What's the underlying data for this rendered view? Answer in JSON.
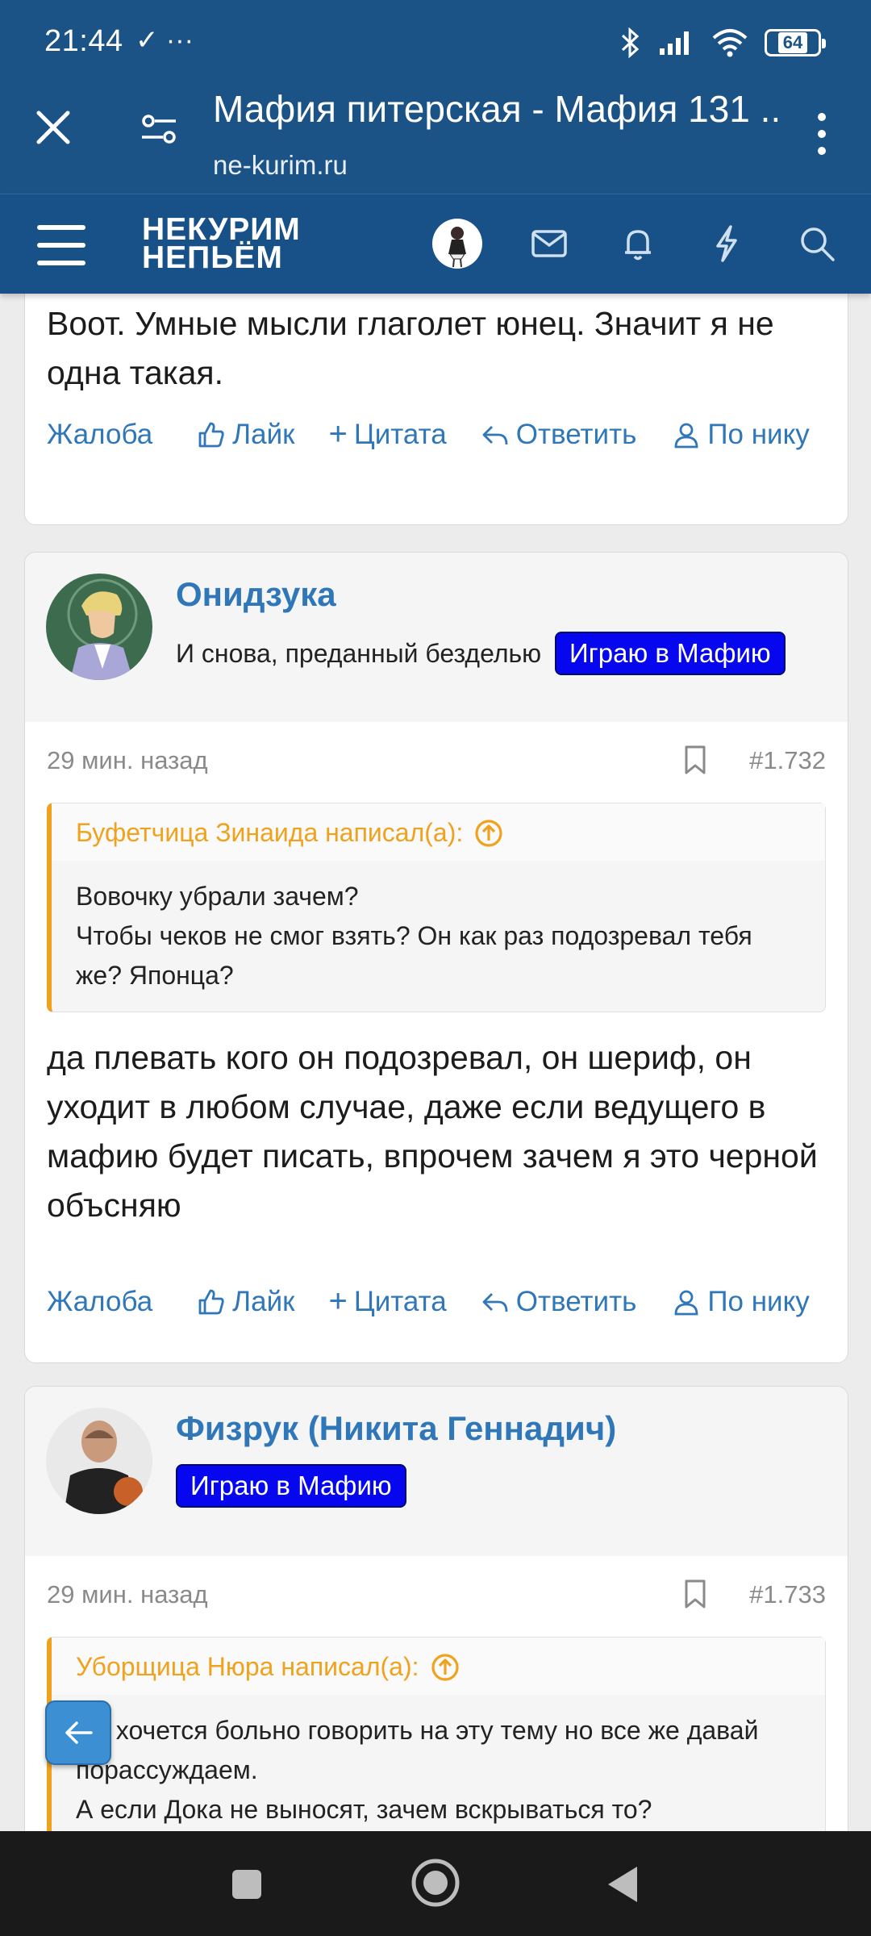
{
  "status": {
    "time": "21:44",
    "battery": "64"
  },
  "browser": {
    "title": "Мафия питерская - Мафия 131 ...",
    "domain": "ne-kurim.ru"
  },
  "site": {
    "logo_line1": "НЕКУРИМ",
    "logo_line2": "НЕПЬЁМ"
  },
  "post_prev": {
    "text": "Воот. Умные мысли глаголет юнец. Значит я не одна такая.",
    "actions": {
      "report": "Жалоба",
      "like": "Лайк",
      "quote": "Цитата",
      "reply": "Ответить",
      "by_nick": "По нику"
    }
  },
  "post1": {
    "username": "Онидзука",
    "user_title": "И снова, преданный безделью",
    "badge": "Играю в Мафию",
    "time": "29 мин. назад",
    "number": "#1.732",
    "quote_author": "Буфетчица Зинаида написал(а):",
    "quote_text": "Вовочку убрали зачем?\nЧтобы чеков не смог взять? Он как раз подозревал тебя же? Японца?",
    "text": "да плевать кого он подозревал, он шериф, он уходит в любом случае, даже если ведущего в мафию будет писать, впрочем зачем я это черной объсняю",
    "actions": {
      "report": "Жалоба",
      "like": "Лайк",
      "quote": "Цитата",
      "reply": "Ответить",
      "by_nick": "По нику"
    }
  },
  "post2": {
    "username": "Физрук (Никита Геннадич)",
    "badge": "Играю в Мафию",
    "time": "29 мин. назад",
    "number": "#1.733",
    "quote_author": "Уборщица Нюра написал(а):",
    "quote_text": "Не хочется больно говорить на эту тему но все же давай порассуждаем.\nА если Дока не выносят, зачем вскрываться то?"
  }
}
